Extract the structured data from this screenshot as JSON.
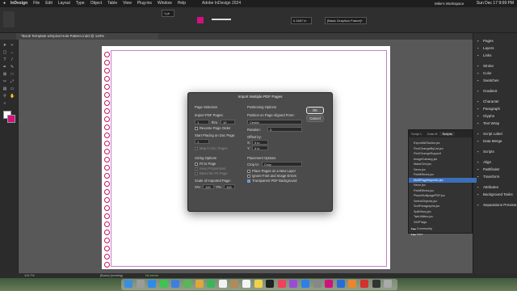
{
  "menubar": {
    "apple": "",
    "items": [
      "InDesign",
      "File",
      "Edit",
      "Layout",
      "Type",
      "Object",
      "Table",
      "View",
      "Plug-ins",
      "Window",
      "Help"
    ],
    "center_title": "Adobe InDesign 2024",
    "clock": "Sun Dec 17  9:09 PM"
  },
  "control": {
    "stroke_weight": "1 pt",
    "zoom_field": "100%",
    "offset_value": "0.1667 in",
    "frame_style": "[Basic Graphics Frame]+",
    "workspace": "Mike's Workspace"
  },
  "document_tab": "*Book Template w/Spiral Hole Pattern.indd @ 119%",
  "dialog": {
    "title": "Import Multiple PDF Pages",
    "page_selection": "Page Selection",
    "import_pages": "Import PDF Pages:",
    "from_value": "1",
    "thru_label": "thru",
    "thru_value": "10",
    "reverse_order": "Reverse Page Order",
    "start_placing": "Start Placing on Doc Page:",
    "start_value": "1",
    "map_pages": "Map to Doc Pages",
    "sizing_options": "Sizing Options",
    "fit_to_page": "Fit to Page",
    "keep_proportions": "Keep Proportions",
    "bleed_fit": "Bleed the Fit Page",
    "scale_label": "Scale of Imported Page:",
    "x_label": "X%:",
    "x_value": "100",
    "y_label": "Y%:",
    "y_value": "100",
    "positioning_options": "Positioning Options",
    "position_label": "Position on Page Aligned From:",
    "position_value": "Center",
    "rotation_label": "Rotation:",
    "rotation_value": "0",
    "offset_by": "Offset by:",
    "x_off_label": "X:",
    "x_off_value": "0 in",
    "y_off_label": "Y:",
    "y_off_value": "0 in",
    "placement_options": "Placement Options",
    "crop_label": "Crop to:",
    "crop_value": "Crop",
    "place_new_layer": "Place Pages on a New Layer",
    "ignore_errors": "Ignore Font and Image Errors",
    "transparent_bg": "Transparent PDF Background",
    "ok": "OK",
    "cancel": "Cancel"
  },
  "panels": [
    {
      "label": "Pages",
      "icon": "pages-icon"
    },
    {
      "label": "Layers",
      "icon": "layers-icon"
    },
    {
      "label": "Links",
      "icon": "links-icon"
    },
    {
      "label": "Stroke",
      "icon": "stroke-icon"
    },
    {
      "label": "Color",
      "icon": "color-icon"
    },
    {
      "label": "Swatches",
      "icon": "swatches-icon"
    },
    {
      "label": "Gradient",
      "icon": "gradient-icon"
    },
    {
      "label": "Character",
      "icon": "character-icon"
    },
    {
      "label": "Paragraph",
      "icon": "paragraph-icon"
    },
    {
      "label": "Glyphs",
      "icon": "glyphs-icon"
    },
    {
      "label": "Text Wrap",
      "icon": "text-wrap-icon"
    },
    {
      "label": "Script Label",
      "icon": "script-label-icon"
    },
    {
      "label": "Data Merge",
      "icon": "data-merge-icon"
    },
    {
      "label": "Scripts",
      "icon": "scripts-icon"
    },
    {
      "label": "Align",
      "icon": "align-icon"
    },
    {
      "label": "Pathfinder",
      "icon": "pathfinder-icon"
    },
    {
      "label": "Transform",
      "icon": "transform-icon"
    },
    {
      "label": "Attributes",
      "icon": "attributes-icon"
    },
    {
      "label": "Background Tasks",
      "icon": "background-tasks-icon"
    },
    {
      "label": "Separations Preview",
      "icon": "separations-icon"
    }
  ],
  "scripts_panel": {
    "tabs": [
      "Script L",
      "Data M",
      "Scripts"
    ],
    "items": [
      "ExportAllStories.jsx",
      "FindChangeByList.jsx",
      "FindChangeSupport",
      "ImageCatalog.jsx",
      "MakeGrid.jsx",
      "Neon.jsx",
      "PathEffects.jsx",
      "MultiPageImporter.jsx",
      "Neon.jsx",
      "PathEffects.jsx",
      "PlaceMultipagePDF.jsx",
      "SelectObjects.jsx",
      "SortParagraphs.jsx",
      "SplitStory.jsx",
      "TabUtilities.jsx",
      "XMPTags"
    ],
    "selected_index": 7,
    "folders": [
      "Community",
      "User"
    ]
  },
  "status": {
    "zoom": "119.7%",
    "page_style": "[Basic] (working)",
    "errors": "No errors"
  },
  "dock_icons": [
    "finder",
    "launchpad",
    "safari",
    "messages",
    "mail",
    "maps",
    "photos",
    "facetime",
    "calendar",
    "contacts",
    "reminders",
    "notes",
    "tv",
    "music",
    "podcasts",
    "app-store",
    "settings",
    "indesign",
    "photoshop",
    "illustrator",
    "acrobat",
    "terminal",
    "trash"
  ]
}
